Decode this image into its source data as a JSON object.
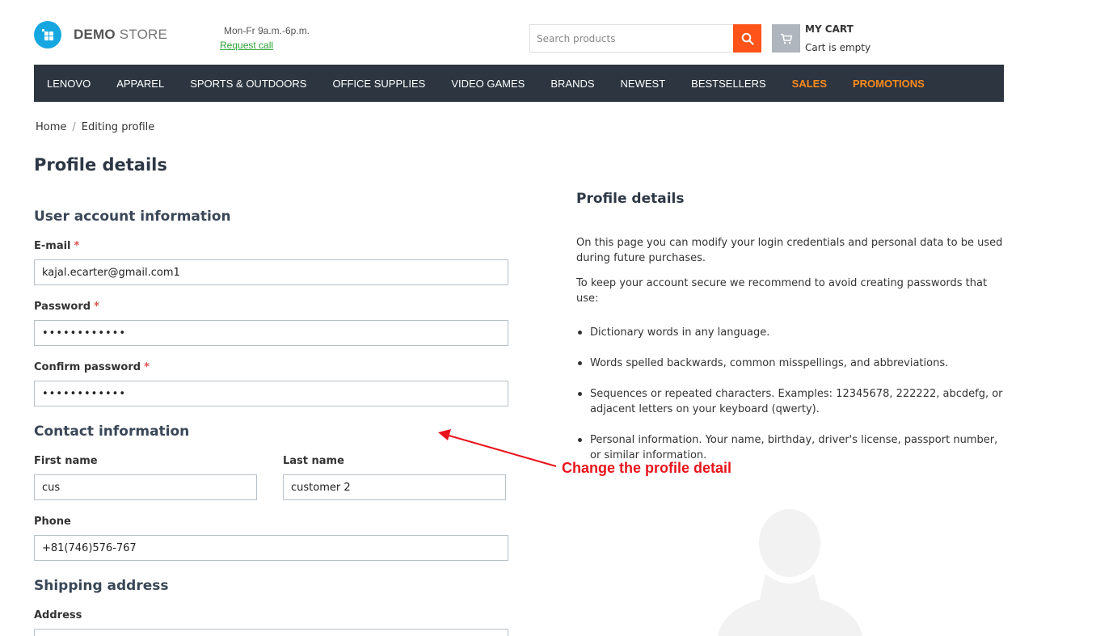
{
  "header": {
    "logo_bold": "DEMO",
    "logo_light": "STORE",
    "hours": "Mon-Fr 9a.m.-6p.m.",
    "request_call": "Request call",
    "search_placeholder": "Search products",
    "cart_title": "MY CART",
    "cart_status": "Cart is empty"
  },
  "nav": {
    "items": [
      "LENOVO",
      "APPAREL",
      "SPORTS & OUTDOORS",
      "OFFICE SUPPLIES",
      "VIDEO GAMES",
      "BRANDS",
      "NEWEST",
      "BESTSELLERS",
      "SALES",
      "PROMOTIONS"
    ],
    "highlight_color": "#ff8a1a"
  },
  "breadcrumb": {
    "home": "Home",
    "separator": "/",
    "current": "Editing profile"
  },
  "page_title": "Profile details",
  "form": {
    "account_section": "User account information",
    "email_label": "E-mail",
    "email_value": "kajal.ecarter@gmail.com1",
    "password_label": "Password",
    "password_value": "••••••••••••",
    "confirm_label": "Confirm password",
    "confirm_value": "••••••••••••",
    "required_mark": "*",
    "contact_section": "Contact information",
    "first_name_label": "First name",
    "first_name_value": "cus",
    "last_name_label": "Last name",
    "last_name_value": "customer 2",
    "phone_label": "Phone",
    "phone_value": "+81(746)576-767",
    "shipping_section": "Shipping address",
    "address_label": "Address"
  },
  "info": {
    "title": "Profile details",
    "paragraph1": "On this page you can modify your login credentials and personal data to be used during future purchases.",
    "paragraph2": "To keep your account secure we recommend to avoid creating passwords that use:",
    "bullets": [
      "Dictionary words in any language.",
      "Words spelled backwards, common misspellings, and abbreviations.",
      "Sequences or repeated characters. Examples: 12345678, 222222, abcdefg, or adjacent letters on your keyboard (qwerty).",
      "Personal information. Your name, birthday, driver's license, passport number, or similar information."
    ]
  },
  "annotation": {
    "text": "Change the profile detail",
    "color": "#e8141b"
  },
  "colors": {
    "accent": "#ff5319",
    "nav_bg": "#2c3540",
    "logo": "#17a7e0",
    "link_green": "#2ba335"
  }
}
